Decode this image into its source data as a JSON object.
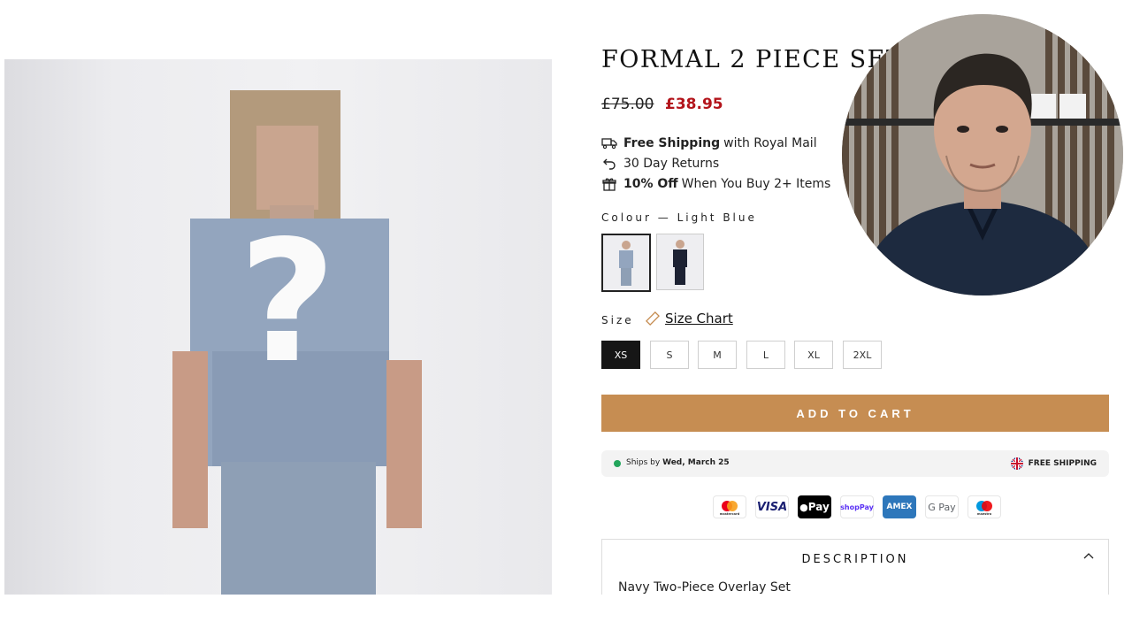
{
  "product": {
    "title": "FORMAL 2 PIECE SET",
    "price_old": "£75.00",
    "price_new": "£38.95",
    "perks": [
      {
        "icon": "delivery-truck-icon",
        "bold": "Free Shipping",
        "text": "with Royal Mail"
      },
      {
        "icon": "return-arrow-icon",
        "bold": "",
        "text": "30 Day Returns"
      },
      {
        "icon": "gift-icon",
        "bold": "10% Off",
        "text": "When You Buy 2+ Items"
      }
    ],
    "colour_label": "Colour — Light Blue",
    "size_label": "Size",
    "size_chart_label": "Size Chart",
    "sizes": [
      "XS",
      "S",
      "M",
      "L",
      "XL",
      "2XL"
    ],
    "selected_size": "XS",
    "add_to_cart": "ADD TO CART",
    "ships_prefix": "Ships by ",
    "ships_date": "Wed, March 25",
    "free_shipping_badge": "FREE SHIPPING",
    "payment_methods": [
      "mastercard",
      "VISA",
      "Pay",
      "shopPay",
      "AMEX",
      "G Pay",
      "maestro"
    ],
    "description_title": "DESCRIPTION",
    "description_text": "Navy Two-Piece Overlay Set"
  },
  "hero": {
    "overlay_symbol": "?"
  },
  "colors": {
    "accent": "#c68d52",
    "sale": "#b3141b",
    "in_stock": "#22a55b"
  }
}
